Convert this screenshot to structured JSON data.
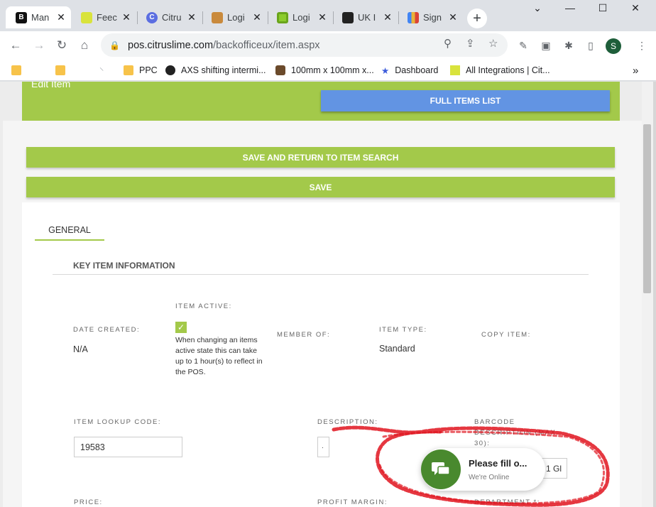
{
  "browser": {
    "tabs": [
      {
        "title": "Man",
        "favicon": "B",
        "favicon_color": "#111111",
        "active": true
      },
      {
        "title": "Feec",
        "favicon": "",
        "favicon_color": "#d9e33c",
        "active": false
      },
      {
        "title": "Citru",
        "favicon": "C",
        "favicon_color": "#5b6ee1",
        "active": false
      },
      {
        "title": "Logi",
        "favicon": "",
        "favicon_color": "#c98a3c",
        "active": false
      },
      {
        "title": "Logi",
        "favicon": "",
        "favicon_color": "#8ccc2c",
        "active": false
      },
      {
        "title": "UK I",
        "favicon": "",
        "favicon_color": "#222222",
        "active": false
      },
      {
        "title": "Sign",
        "favicon": "",
        "favicon_color": "#e8b23a",
        "active": false
      }
    ],
    "address": {
      "domain": "pos.citruslime.com",
      "path": "/backofficeux/item.aspx"
    },
    "profile_initial": "S",
    "bookmarks": [
      {
        "label": ""
      },
      {
        "label": ""
      },
      {
        "label": ""
      },
      {
        "label": "PPC"
      },
      {
        "label": "AXS shifting intermi..."
      },
      {
        "label": "100mm x 100mm x..."
      },
      {
        "label": "Dashboard"
      },
      {
        "label": "All Integrations | Cit..."
      }
    ],
    "bookmarks_more": "»"
  },
  "page": {
    "edit_title": "Edit Item",
    "full_items_button": "FULL ITEMS LIST",
    "save_return_button": "SAVE AND RETURN TO ITEM SEARCH",
    "save_button": "SAVE",
    "tab_general": "GENERAL",
    "section_title": "KEY ITEM INFORMATION",
    "fields": {
      "date_created_label": "DATE CREATED:",
      "date_created_value": "N/A",
      "item_active_label": "ITEM ACTIVE:",
      "item_active_note": "When changing an items active state this can take up to 1 hour(s) to reflect in the POS.",
      "member_of_label": "MEMBER OF:",
      "item_type_label": "ITEM TYPE:",
      "item_type_value": "Standard",
      "copy_item_label": "COPY ITEM:",
      "lookup_code_label": "ITEM LOOKUP CODE:",
      "lookup_code_value": "19583",
      "description_label": "DESCRIPTION:",
      "description_value": "·",
      "barcode_label": "BARCODE DESCRIPTION (MAX 30):",
      "barcode_value": "1 Gl",
      "price_label": "PRICE:",
      "profit_margin_label": "PROFIT MARGIN:",
      "department_label": "DEPARTMENT *:"
    }
  },
  "chat": {
    "title": "Please fill o...",
    "subtitle": "We're Online"
  },
  "colors": {
    "accent_green": "#a3c94a",
    "button_blue": "#6294e3",
    "chat_green": "#49892e",
    "annotation_red": "#e0141e"
  }
}
